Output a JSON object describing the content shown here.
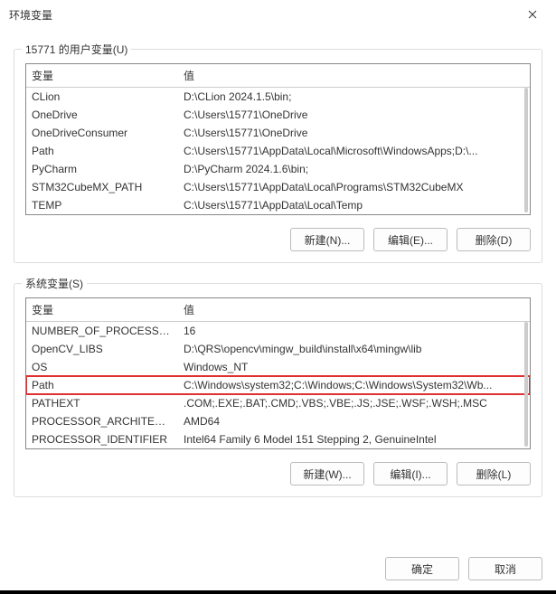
{
  "window": {
    "title": "环境变量"
  },
  "userGroup": {
    "label": "15771 的用户变量(U)",
    "headers": {
      "name": "变量",
      "value": "值"
    },
    "rows": [
      {
        "name": "CLion",
        "value": "D:\\CLion 2024.1.5\\bin;"
      },
      {
        "name": "OneDrive",
        "value": "C:\\Users\\15771\\OneDrive"
      },
      {
        "name": "OneDriveConsumer",
        "value": "C:\\Users\\15771\\OneDrive"
      },
      {
        "name": "Path",
        "value": "C:\\Users\\15771\\AppData\\Local\\Microsoft\\WindowsApps;D:\\..."
      },
      {
        "name": "PyCharm",
        "value": "D:\\PyCharm 2024.1.6\\bin;"
      },
      {
        "name": "STM32CubeMX_PATH",
        "value": "C:\\Users\\15771\\AppData\\Local\\Programs\\STM32CubeMX"
      },
      {
        "name": "TEMP",
        "value": "C:\\Users\\15771\\AppData\\Local\\Temp"
      }
    ],
    "buttons": {
      "new": "新建(N)...",
      "edit": "编辑(E)...",
      "delete": "删除(D)"
    }
  },
  "systemGroup": {
    "label": "系统变量(S)",
    "headers": {
      "name": "变量",
      "value": "值"
    },
    "rows": [
      {
        "name": "NUMBER_OF_PROCESSORS",
        "value": "16"
      },
      {
        "name": "OpenCV_LIBS",
        "value": "D:\\QRS\\opencv\\mingw_build\\install\\x64\\mingw\\lib"
      },
      {
        "name": "OS",
        "value": "Windows_NT"
      },
      {
        "name": "Path",
        "value": "C:\\Windows\\system32;C:\\Windows;C:\\Windows\\System32\\Wb..."
      },
      {
        "name": "PATHEXT",
        "value": ".COM;.EXE;.BAT;.CMD;.VBS;.VBE;.JS;.JSE;.WSF;.WSH;.MSC"
      },
      {
        "name": "PROCESSOR_ARCHITECT...",
        "value": "AMD64"
      },
      {
        "name": "PROCESSOR_IDENTIFIER",
        "value": "Intel64 Family 6 Model 151 Stepping 2, GenuineIntel"
      }
    ],
    "selectedIndex": 3,
    "buttons": {
      "new": "新建(W)...",
      "edit": "编辑(I)...",
      "delete": "删除(L)"
    }
  },
  "footer": {
    "ok": "确定",
    "cancel": "取消"
  }
}
